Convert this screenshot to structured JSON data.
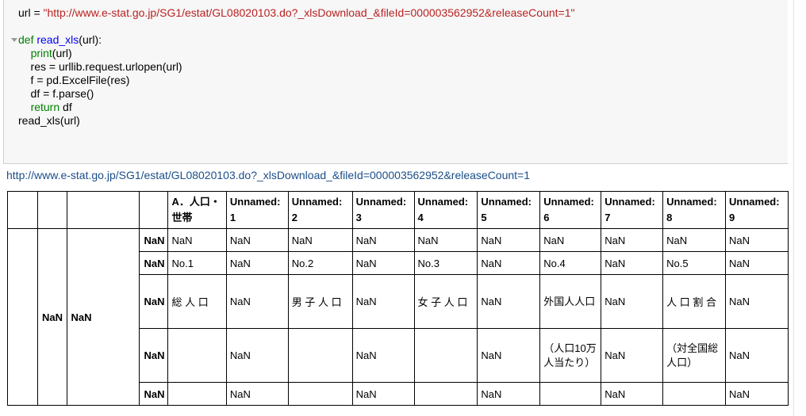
{
  "code": {
    "line1_var": "url = ",
    "line1_str": "\"http://www.e-stat.go.jp/SG1/estat/GL08020103.do?_xlsDownload_&fileId=000003562952&releaseCount=1\"",
    "line3_kw": "def ",
    "line3_fn": "read_xls",
    "line3_rest": "(url):",
    "line4_kw": "print",
    "line4_rest": "(url)",
    "line5": "    res = urllib.request.urlopen(url)",
    "line6": "    f = pd.ExcelFile(res)",
    "line7": "    df = f.parse()",
    "line8_kw": "return",
    "line8_rest": " df",
    "line9": "read_xls(url)"
  },
  "output": {
    "url": "http://www.e-stat.go.jp/SG1/estat/GL08020103.do?_xlsDownload_&fileId=000003562952&releaseCount=1"
  },
  "table": {
    "headers": [
      "A．人口・世帯",
      "Unnamed: 1",
      "Unnamed: 2",
      "Unnamed: 3",
      "Unnamed: 4",
      "Unnamed: 5",
      "Unnamed: 6",
      "Unnamed: 7",
      "Unnamed: 8",
      "Unnamed: 9"
    ],
    "index_level2": "NaN",
    "index_level3": "NaN",
    "row_index": [
      "NaN",
      "NaN",
      "NaN",
      "NaN",
      "NaN"
    ],
    "rows": [
      [
        "NaN",
        "NaN",
        "NaN",
        "NaN",
        "NaN",
        "NaN",
        "NaN",
        "NaN",
        "NaN",
        "NaN"
      ],
      [
        "No.1",
        "NaN",
        "No.2",
        "NaN",
        "No.3",
        "NaN",
        "No.4",
        "NaN",
        "No.5",
        "NaN"
      ],
      [
        "総 人 口",
        "NaN",
        "男 子 人 口",
        "NaN",
        "女 子 人 口",
        "NaN",
        "外国人人口",
        "NaN",
        "人 口 割 合",
        "NaN"
      ],
      [
        "",
        "NaN",
        "",
        "NaN",
        "",
        "NaN",
        "（人口10万人当たり）",
        "NaN",
        "（対全国総人口）",
        "NaN"
      ],
      [
        "",
        "NaN",
        "",
        "NaN",
        "",
        "NaN",
        "",
        "NaN",
        "",
        "NaN"
      ]
    ]
  }
}
